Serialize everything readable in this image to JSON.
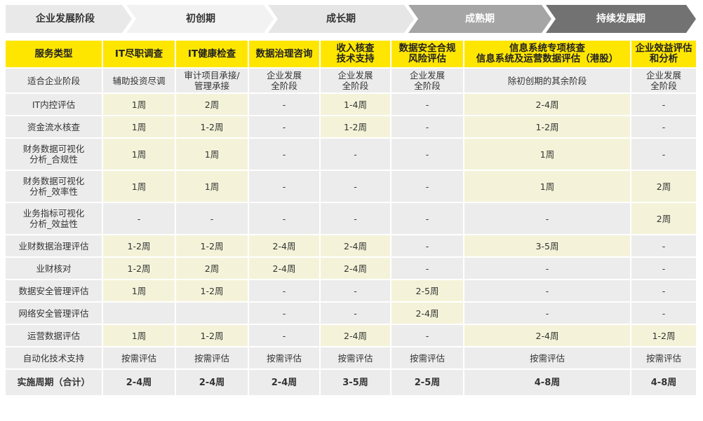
{
  "stages": {
    "title": "企业发展阶段",
    "items": [
      "初创期",
      "成长期",
      "成熟期",
      "持续发展期"
    ]
  },
  "table": {
    "headers": [
      {
        "lines": [
          "服务类型"
        ]
      },
      {
        "lines": [
          "IT尽职调查"
        ]
      },
      {
        "lines": [
          "IT健康检查"
        ]
      },
      {
        "lines": [
          "数据治理咨询"
        ]
      },
      {
        "lines": [
          "收入核查",
          "技术支持"
        ]
      },
      {
        "lines": [
          "数据安全合规",
          "风险评估"
        ]
      },
      {
        "lines": [
          "信息系统专项核查",
          "信息系统及运营数据评估（港股）"
        ]
      },
      {
        "lines": [
          "企业效益评估",
          "和分析"
        ]
      }
    ],
    "rows": [
      {
        "label": [
          "适合企业阶段"
        ],
        "cells": [
          [
            "辅助投资尽调"
          ],
          [
            "审计项目承接/",
            "管理承接"
          ],
          [
            "企业发展",
            "全阶段"
          ],
          [
            "企业发展",
            "全阶段"
          ],
          [
            "企业发展",
            "全阶段"
          ],
          [
            "除初创期的其余阶段"
          ],
          [
            "企业发展",
            "全阶段"
          ]
        ]
      },
      {
        "label": [
          "IT内控评估"
        ],
        "cells": [
          [
            "1周"
          ],
          [
            "2周"
          ],
          [
            "-"
          ],
          [
            "1-4周"
          ],
          [
            "-"
          ],
          [
            "2-4周"
          ],
          [
            "-"
          ]
        ]
      },
      {
        "label": [
          "资金流水核查"
        ],
        "cells": [
          [
            "1周"
          ],
          [
            "1-2周"
          ],
          [
            "-"
          ],
          [
            "1-2周"
          ],
          [
            "-"
          ],
          [
            "1-2周"
          ],
          [
            "-"
          ]
        ]
      },
      {
        "label": [
          "财务数据可视化",
          "分析_合规性"
        ],
        "cells": [
          [
            "1周"
          ],
          [
            "1周"
          ],
          [
            "-"
          ],
          [
            "-"
          ],
          [
            "-"
          ],
          [
            "1周"
          ],
          [
            "-"
          ]
        ]
      },
      {
        "label": [
          "财务数据可视化",
          "分析_效率性"
        ],
        "cells": [
          [
            "1周"
          ],
          [
            "1周"
          ],
          [
            "-"
          ],
          [
            "-"
          ],
          [
            "-"
          ],
          [
            "1周"
          ],
          [
            "2周"
          ]
        ]
      },
      {
        "label": [
          "业务指标可视化",
          "分析_效益性"
        ],
        "cells": [
          [
            "-"
          ],
          [
            "-"
          ],
          [
            "-"
          ],
          [
            "-"
          ],
          [
            "-"
          ],
          [
            "-"
          ],
          [
            "2周"
          ]
        ]
      },
      {
        "label": [
          "业财数据治理评估"
        ],
        "cells": [
          [
            "1-2周"
          ],
          [
            "1-2周"
          ],
          [
            "2-4周"
          ],
          [
            "2-4周"
          ],
          [
            "-"
          ],
          [
            "3-5周"
          ],
          [
            "-"
          ]
        ]
      },
      {
        "label": [
          "业财核对"
        ],
        "cells": [
          [
            "1-2周"
          ],
          [
            "2周"
          ],
          [
            "2-4周"
          ],
          [
            "2-4周"
          ],
          [
            "-"
          ],
          [
            "-"
          ],
          [
            "-"
          ]
        ]
      },
      {
        "label": [
          "数据安全管理评估"
        ],
        "cells": [
          [
            "1周"
          ],
          [
            "1-2周"
          ],
          [
            "-"
          ],
          [
            "-"
          ],
          [
            "2-5周"
          ],
          [
            "-"
          ],
          [
            "-"
          ]
        ]
      },
      {
        "label": [
          "网络安全管理评估"
        ],
        "cells": [
          [
            ""
          ],
          [
            ""
          ],
          [
            "-"
          ],
          [
            "-"
          ],
          [
            "2-4周"
          ],
          [
            "-"
          ],
          [
            "-"
          ]
        ]
      },
      {
        "label": [
          "运营数据评估"
        ],
        "cells": [
          [
            "1周"
          ],
          [
            "1-2周"
          ],
          [
            "-"
          ],
          [
            "2-4周"
          ],
          [
            "-"
          ],
          [
            "2-4周"
          ],
          [
            "1-2周"
          ]
        ]
      },
      {
        "label": [
          "自动化技术支持"
        ],
        "cells": [
          [
            "按需评估"
          ],
          [
            "按需评估"
          ],
          [
            "按需评估"
          ],
          [
            "按需评估"
          ],
          [
            "按需评估"
          ],
          [
            "按需评估"
          ],
          [
            "按需评估"
          ]
        ]
      }
    ],
    "total": {
      "label": "实施周期（合计）",
      "cells": [
        "2-4周",
        "2-4周",
        "2-4周",
        "3-5周",
        "2-5周",
        "4-8周",
        "4-8周"
      ]
    }
  },
  "colors": {
    "accent": "#ffe600",
    "highlight": "#f4f3d9",
    "grey": "#ececec",
    "arrow_light": "#e6e6e6",
    "arrow_mid": "#9a9a9a",
    "arrow_dark": "#6e6e6e"
  }
}
